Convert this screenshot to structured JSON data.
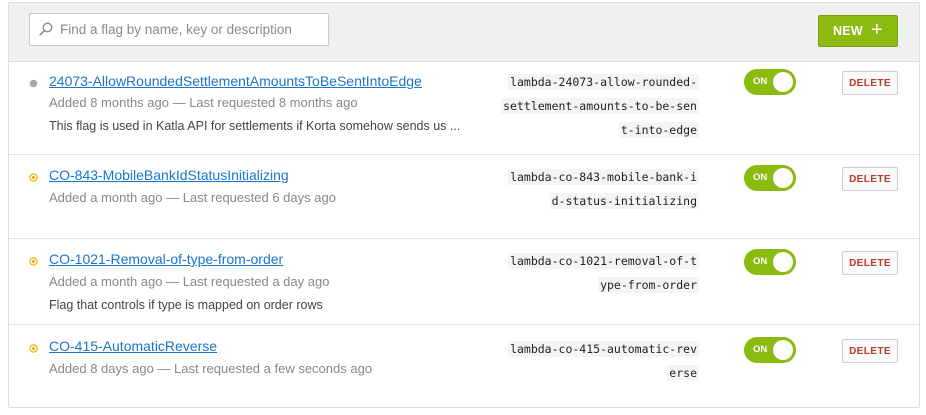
{
  "search": {
    "placeholder": "Find a flag by name, key or description"
  },
  "toolbar": {
    "new_label": "NEW"
  },
  "flags": [
    {
      "name": "24073-AllowRoundedSettlementAmountsToBeSentIntoEdge",
      "meta": "Added 8 months ago — Last requested 8 months ago",
      "description": "This flag is used in Katla API for settlements if Korta somehow sends us ...",
      "key_lines": [
        "lambda-24073-allow-rounded-",
        "settlement-amounts-to-be-sen",
        "t-into-edge"
      ],
      "status": "inactive",
      "toggle": "ON",
      "delete": "DELETE"
    },
    {
      "name": "CO-843-MobileBankIdStatusInitializing",
      "meta": "Added a month ago — Last requested 6 days ago",
      "description": "",
      "key_lines": [
        "lambda-co-843-mobile-bank-i",
        "d-status-initializing"
      ],
      "status": "active",
      "toggle": "ON",
      "delete": "DELETE"
    },
    {
      "name": "CO-1021-Removal-of-type-from-order",
      "meta": "Added a month ago — Last requested a day ago",
      "description": "Flag that controls if type is mapped on order rows",
      "key_lines": [
        "lambda-co-1021-removal-of-t",
        "ype-from-order"
      ],
      "status": "active",
      "toggle": "ON",
      "delete": "DELETE"
    },
    {
      "name": "CO-415-AutomaticReverse",
      "meta": "Added 8 days ago — Last requested a few seconds ago",
      "description": "",
      "key_lines": [
        "lambda-co-415-automatic-rev",
        "erse"
      ],
      "status": "active",
      "toggle": "ON",
      "delete": "DELETE"
    }
  ],
  "colors": {
    "accent": "#8bbb11",
    "link": "#1b76c9",
    "danger": "#c0392b",
    "status_active": "#f0b400",
    "status_inactive": "#a8a8a8"
  }
}
